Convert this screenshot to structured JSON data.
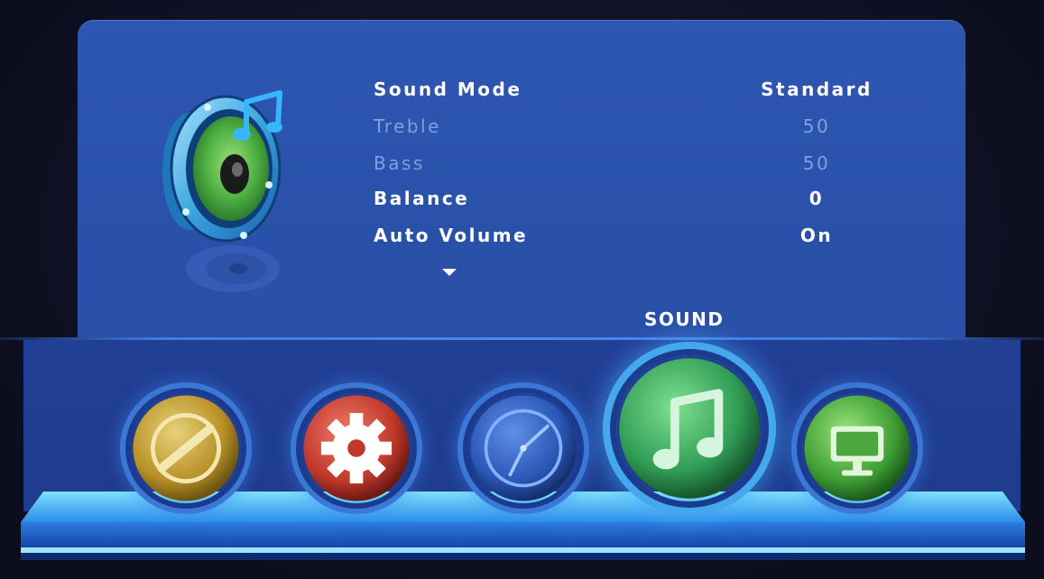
{
  "settings": {
    "rows": [
      {
        "label": "Sound Mode",
        "value": "Standard",
        "enabled": true
      },
      {
        "label": "Treble",
        "value": "50",
        "enabled": false
      },
      {
        "label": "Bass",
        "value": "50",
        "enabled": false
      },
      {
        "label": "Balance",
        "value": "0",
        "enabled": true
      },
      {
        "label": "Auto Volume",
        "value": "On",
        "enabled": true
      }
    ]
  },
  "menu": {
    "active_title": "SOUND",
    "items": [
      {
        "icon": "picture-dial-icon",
        "color": "#c9a83a"
      },
      {
        "icon": "gear-icon",
        "color": "#d04a3a"
      },
      {
        "icon": "clock-icon",
        "color": "#2f5fbf"
      },
      {
        "icon": "music-note-icon",
        "color": "#3fae5a"
      },
      {
        "icon": "monitor-icon",
        "color": "#4cb84a"
      }
    ]
  },
  "colors": {
    "panel": "#2d57b3",
    "glow": "#45a8ee",
    "text": "#ffffff",
    "text_disabled": "#7f9fe0"
  }
}
